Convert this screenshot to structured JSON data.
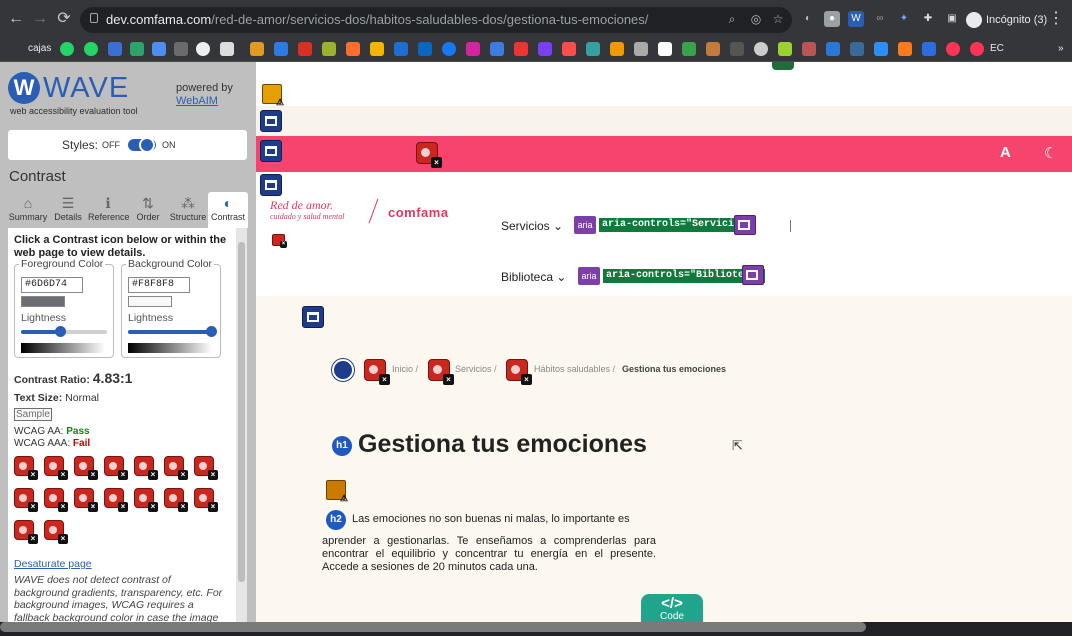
{
  "browser": {
    "url_domain": "dev.comfama.com",
    "url_path": "/red-de-amor/servicios-dos/habitos-saludables-dos/gestiona-tus-emociones/",
    "profile_label": "Incógnito (3)",
    "bookmark_first": "cajas",
    "bookmark_last": "EC",
    "nav_icons": {
      "back": "←",
      "forward": "→",
      "reload": "⟳",
      "menu": "⋮"
    }
  },
  "wave": {
    "title": "WAVE",
    "subtitle": "web accessibility evaluation tool",
    "powered_by": "powered by",
    "powered_link": "WebAIM",
    "styles_label": "Styles:",
    "styles_off": "OFF",
    "styles_on": "ON",
    "section": "Contrast",
    "tabs": [
      {
        "label": "Summary",
        "icon": "home-icon",
        "glyph": "⌂"
      },
      {
        "label": "Details",
        "icon": "list-icon",
        "glyph": "☰"
      },
      {
        "label": "Reference",
        "icon": "info-icon",
        "glyph": "ℹ"
      },
      {
        "label": "Order",
        "icon": "order-icon",
        "glyph": "⇅"
      },
      {
        "label": "Structure",
        "icon": "structure-icon",
        "glyph": "⁂"
      },
      {
        "label": "Contrast",
        "icon": "contrast-icon",
        "glyph": "◐"
      }
    ],
    "instructions": "Click a Contrast icon below or within the web page to view details.",
    "foreground": {
      "label": "Foreground Color",
      "hex": "#6D6D74",
      "lightness_label": "Lightness",
      "lightness": 0.45
    },
    "background": {
      "label": "Background Color",
      "hex": "#F8F8F8",
      "lightness_label": "Lightness",
      "lightness": 0.97
    },
    "ratio_label": "Contrast Ratio:",
    "ratio_value": "4.83:1",
    "text_size_label": "Text Size:",
    "text_size_value": "Normal",
    "sample": "Sample",
    "wcag_aa_label": "WCAG AA:",
    "wcag_aa_value": "Pass",
    "wcag_aaa_label": "WCAG AAA:",
    "wcag_aaa_value": "Fail",
    "contrast_error_count": 16,
    "desaturate_link": "Desaturate page",
    "note": "WAVE does not detect contrast of background gradients, transparency, etc. For background images, WCAG requires a fallback background color in case the image does not display."
  },
  "page": {
    "accent": "#f5456f",
    "brand_line1": "Red de amor.",
    "brand_line2": "cuidado y salud mental",
    "brand2": "comfama",
    "accessibility_icon": "A",
    "theme_icon": "☾",
    "menu1": "Servicios",
    "menu1_aria": "aria",
    "menu1_code": "aria-controls=\"Servicios\"",
    "menu2": "Biblioteca",
    "menu2_aria": "aria",
    "menu2_code": "aria-controls=\"Biblioteca\"",
    "crumb1": "Inicio /",
    "crumb2": "Servicios /",
    "crumb3": "Hábitos saludables /",
    "crumb_current": "Gestiona tus emociones",
    "h1_badge": "h1",
    "h1": "Gestiona tus emociones",
    "h2_badge": "h2",
    "para1": "Las emociones no son buenas ni malas, lo importante es",
    "para2": "aprender a gestionarlas. Te enseñamos a comprenderlas para encontrar el equilibrio y concentrar tu energía en el presente. Accede a sesiones de 20 minutos cada una.",
    "code_glyph": "</>",
    "code_label": "Code"
  }
}
